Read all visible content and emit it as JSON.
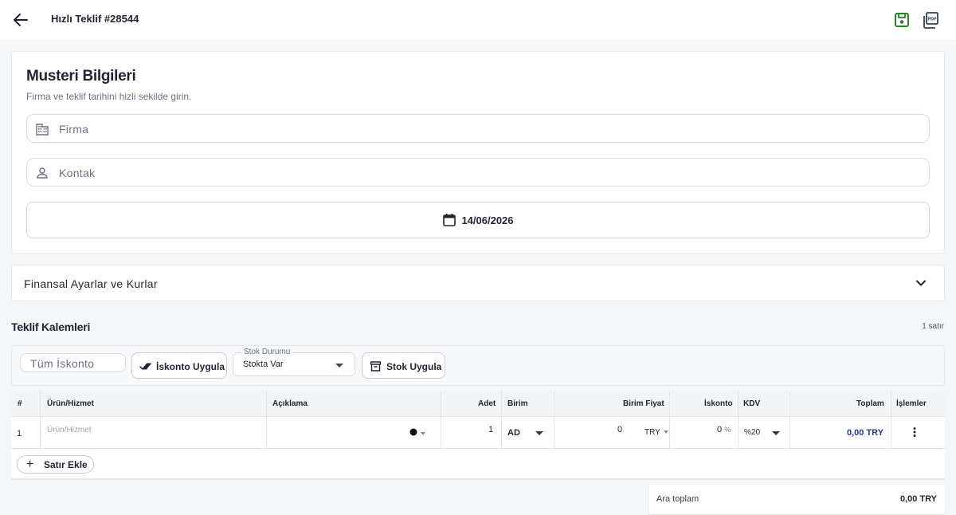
{
  "header": {
    "title": "Hızlı Teklif #28544"
  },
  "customer": {
    "title": "Musteri Bilgileri",
    "subtitle": "Firma ve teklif tarihini hizli sekilde girin.",
    "firma_placeholder": "Firma",
    "kontak_placeholder": "Kontak",
    "date": "14/06/2026"
  },
  "finance": {
    "label": "Finansal Ayarlar ve Kurlar"
  },
  "items": {
    "title": "Teklif Kalemleri",
    "row_count": "1 satır",
    "toolbar": {
      "discount_placeholder": "Tüm İskonto",
      "apply_discount_label": "İskonto Uygula",
      "stock_legend": "Stok Durumu",
      "stock_value": "Stokta Var",
      "apply_stock_label": "Stok Uygula"
    },
    "columns": {
      "index": "#",
      "product": "Ürün/Hizmet",
      "description": "Açıklama",
      "quantity": "Adet",
      "unit": "Birim",
      "unit_price": "Birim Fiyat",
      "discount": "İskonto",
      "vat": "KDV",
      "total": "Toplam",
      "actions": "İşlemler"
    },
    "rows": [
      {
        "index": "1",
        "product_placeholder": "Ürün/Hizmet",
        "quantity": "1",
        "unit": "AD",
        "unit_price": "0",
        "currency": "TRY",
        "discount": "0",
        "discount_unit": "%",
        "vat": "%20",
        "total": "0,00 TRY"
      }
    ],
    "add_row_label": "Satır Ekle"
  },
  "totals": {
    "subtotal_label": "Ara toplam",
    "subtotal_value": "0,00 TRY"
  },
  "colors": {
    "save_icon": "#2e7d32",
    "text_primary": "#1f2430",
    "text_muted": "#6b7280",
    "total_value": "#1e3a8a"
  }
}
